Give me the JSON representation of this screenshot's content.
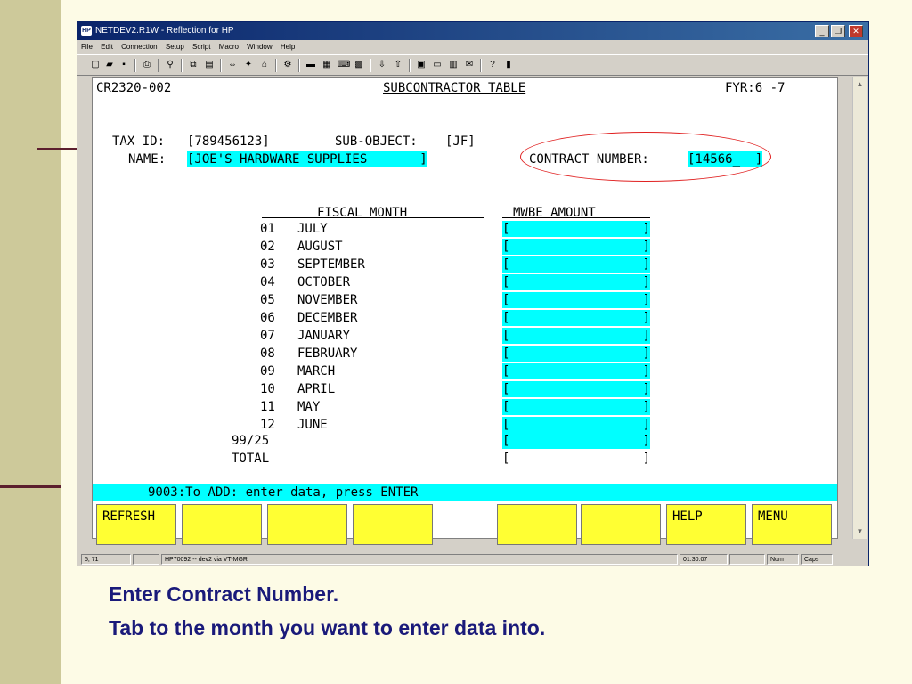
{
  "window": {
    "title": "NETDEV2.R1W - Reflection for HP",
    "menu": [
      "File",
      "Edit",
      "Connection",
      "Setup",
      "Script",
      "Macro",
      "Window",
      "Help"
    ]
  },
  "screen": {
    "screen_id": "CR2320-002",
    "title": "SUBCONTRACTOR TABLE",
    "fyr": "FYR:6 -7",
    "tax_id_label": "TAX ID:",
    "tax_id_value": "[789456123]",
    "sub_object_label": "SUB-OBJECT:",
    "sub_object_value": "[JF]",
    "name_label": "NAME:",
    "name_value": "[JOE'S HARDWARE SUPPLIES       ]",
    "contract_label": "CONTRACT NUMBER:",
    "contract_value": "[14566_  ]",
    "fiscal_month_header": "FISCAL MONTH",
    "mwbe_header": "MWBE AMOUNT",
    "months": [
      {
        "num": "01",
        "name": "JULY"
      },
      {
        "num": "02",
        "name": "AUGUST"
      },
      {
        "num": "03",
        "name": "SEPTEMBER"
      },
      {
        "num": "04",
        "name": "OCTOBER"
      },
      {
        "num": "05",
        "name": "NOVEMBER"
      },
      {
        "num": "06",
        "name": "DECEMBER"
      },
      {
        "num": "07",
        "name": "JANUARY"
      },
      {
        "num": "08",
        "name": "FEBRUARY"
      },
      {
        "num": "09",
        "name": "MARCH"
      },
      {
        "num": "10",
        "name": "APRIL"
      },
      {
        "num": "11",
        "name": "MAY"
      },
      {
        "num": "12",
        "name": "JUNE"
      }
    ],
    "period_99": "99/25",
    "total_label": "TOTAL",
    "bracket_open": "[",
    "bracket_close": "]",
    "message": "9003:To ADD: enter data, press ENTER",
    "fkeys": [
      "REFRESH",
      "",
      "",
      "",
      "",
      "",
      "",
      "HELP",
      "MENU"
    ]
  },
  "statusbar": {
    "cursor": "5, 71",
    "session": "HP70092 -- dev2 via VT-MGR",
    "time": "01:30:07",
    "num": "Num",
    "caps": "Caps"
  },
  "caption": {
    "line1": "Enter Contract Number.",
    "line2": "Tab to the month you want to enter data into."
  },
  "colors": {
    "field_highlight": "#00ffff",
    "fkey_bg": "#ffff33",
    "annotation_oval": "#e02020",
    "caption_text": "#1a1a7a"
  }
}
